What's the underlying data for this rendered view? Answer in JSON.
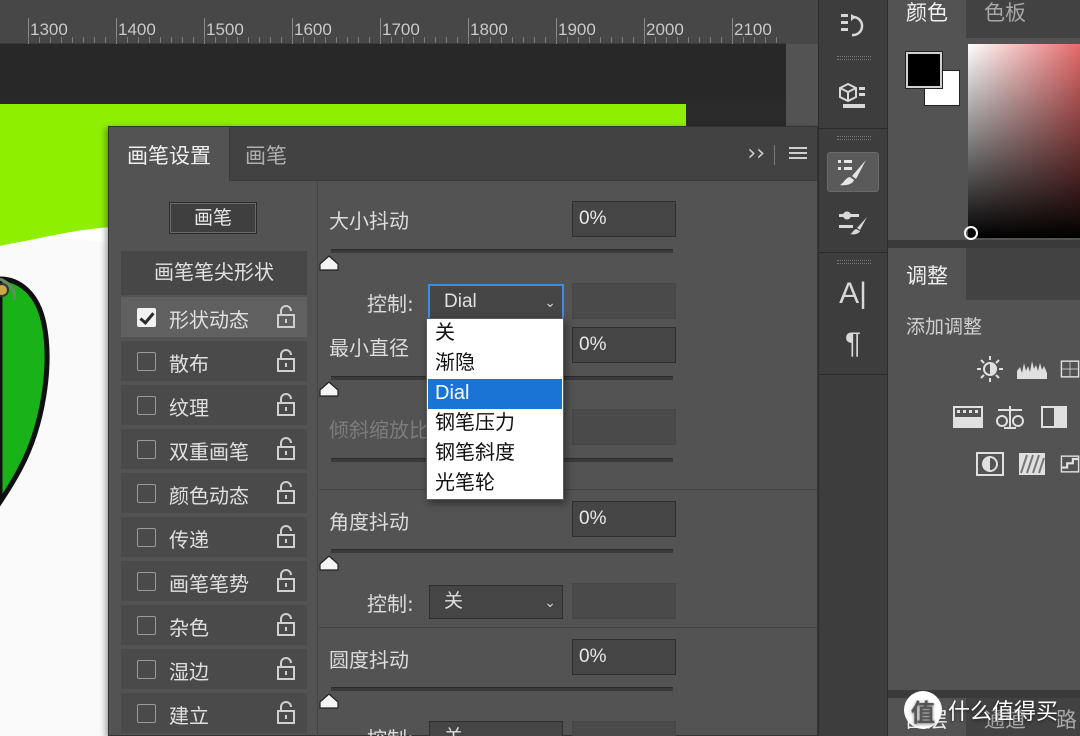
{
  "ruler": {
    "labels": [
      "1300",
      "1400",
      "1500",
      "1600",
      "1700",
      "1800",
      "1900",
      "2000",
      "2100"
    ]
  },
  "brush_panel": {
    "tabs": [
      "画笔设置",
      "画笔"
    ],
    "collapse_glyph": "››",
    "brushes_button": "画笔",
    "tip_shape_label": "画笔笔尖形状",
    "categories": [
      {
        "label": "形状动态",
        "checked": true
      },
      {
        "label": "散布",
        "checked": false
      },
      {
        "label": "纹理",
        "checked": false
      },
      {
        "label": "双重画笔",
        "checked": false
      },
      {
        "label": "颜色动态",
        "checked": false
      },
      {
        "label": "传递",
        "checked": false
      },
      {
        "label": "画笔笔势",
        "checked": false
      },
      {
        "label": "杂色",
        "checked": false
      },
      {
        "label": "湿边",
        "checked": false
      },
      {
        "label": "建立",
        "checked": false
      }
    ],
    "size_jitter": {
      "label": "大小抖动",
      "value": "0%"
    },
    "control_label": "控制:",
    "size_control": "Dial",
    "min_diameter": {
      "label": "最小直径",
      "value": "0%"
    },
    "tilt_scale": {
      "label": "倾斜缩放比"
    },
    "angle_jitter": {
      "label": "角度抖动",
      "value": "0%"
    },
    "angle_control": "关",
    "roundness_jitter": {
      "label": "圆度抖动",
      "value": "0%"
    },
    "roundness_control": "关",
    "dropdown_options": [
      "关",
      "渐隐",
      "Dial",
      "钢笔压力",
      "钢笔斜度",
      "光笔轮"
    ],
    "dropdown_selected": "Dial"
  },
  "tool_strip": {
    "icons": [
      "history-icon",
      "3d-icon",
      "brush-settings-icon",
      "brush-preset-icon",
      "character-icon",
      "paragraph-icon"
    ],
    "character_glyph": "A|",
    "paragraph_glyph": "¶"
  },
  "right_panels": {
    "color_tabs": [
      "颜色",
      "色板"
    ],
    "foreground_color": "#000000",
    "background_color": "#ffffff",
    "adjustments_tab": "调整",
    "adjustments_subtitle": "添加调整",
    "layers_tabs": [
      "图层",
      "通道",
      "路"
    ]
  },
  "watermark": {
    "logo_glyph": "值",
    "text": "什么值得买"
  },
  "colors": {
    "accent_green": "#8fef00",
    "selection_blue": "#1a74d6"
  }
}
